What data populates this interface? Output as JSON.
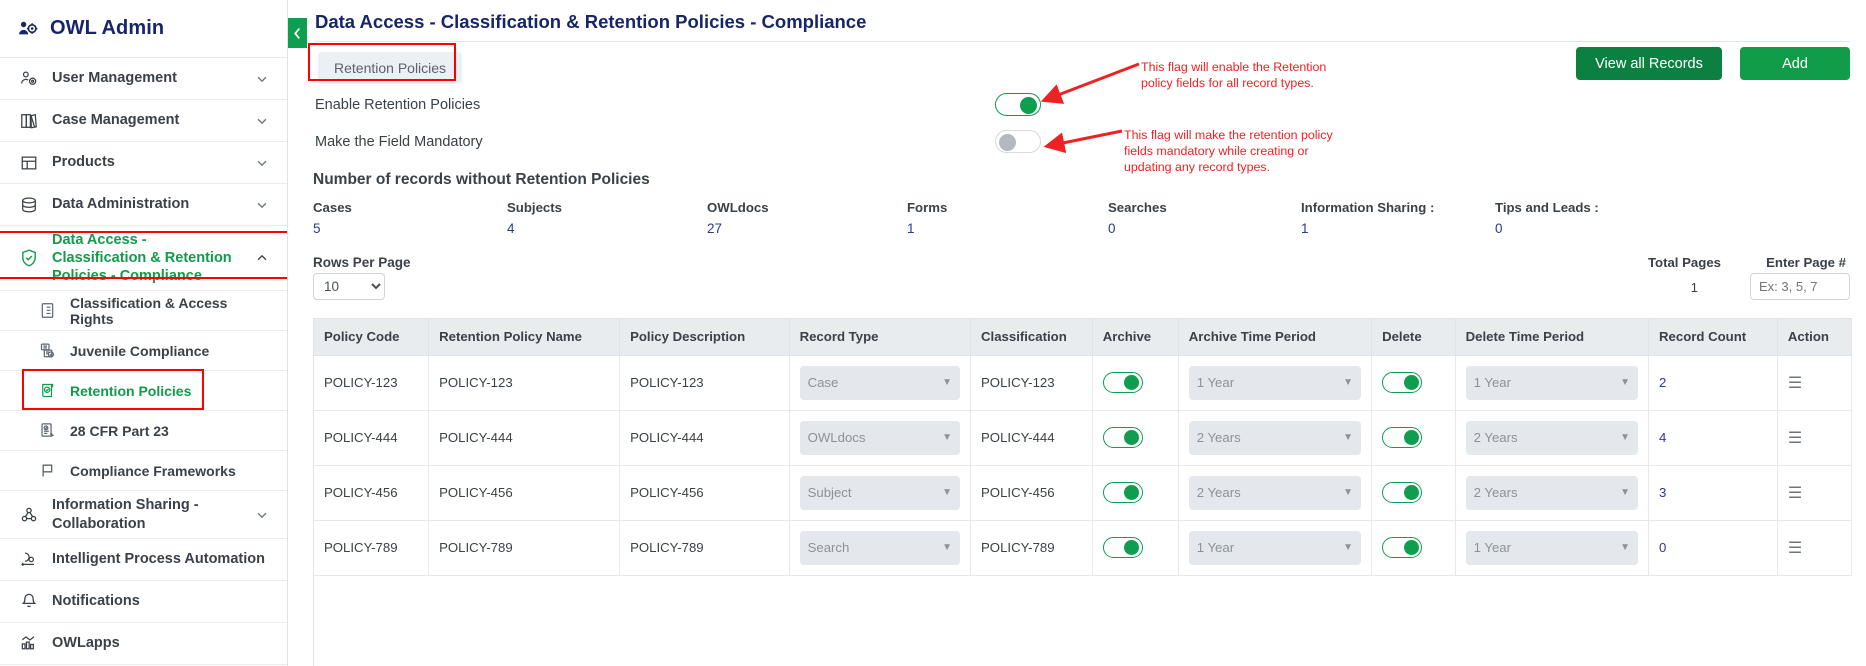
{
  "brand": {
    "title": "OWL Admin",
    "icon": "users-gear-icon"
  },
  "sidebar": {
    "items": [
      {
        "label": "User Management",
        "icon": "user-gear-icon",
        "chevron": "chevron-down-icon"
      },
      {
        "label": "Case Management",
        "icon": "books-icon",
        "chevron": "chevron-down-icon"
      },
      {
        "label": "Products",
        "icon": "layout-icon",
        "chevron": "chevron-down-icon"
      },
      {
        "label": "Data Administration",
        "icon": "database-icon",
        "chevron": "chevron-down-icon"
      },
      {
        "label": "Data Access - Classification & Retention Policies - Compliance",
        "icon": "shield-check-icon",
        "chevron": "chevron-up-icon"
      }
    ],
    "sub_items": [
      {
        "label": "Classification & Access Rights",
        "icon": "document-list-icon"
      },
      {
        "label": "Juvenile Compliance",
        "icon": "document-check-icon"
      },
      {
        "label": "Retention Policies",
        "icon": "scroll-check-icon"
      },
      {
        "label": "28 CFR Part 23",
        "icon": "document-edit-icon"
      },
      {
        "label": "Compliance Frameworks",
        "icon": "flag-icon"
      }
    ],
    "tail_items": [
      {
        "label": "Information Sharing - Collaboration",
        "icon": "share-nodes-icon",
        "chevron": "chevron-down-icon"
      },
      {
        "label": "Intelligent Process Automation",
        "icon": "automation-icon",
        "chevron": ""
      },
      {
        "label": "Notifications",
        "icon": "bell-icon",
        "chevron": ""
      },
      {
        "label": "OWLapps",
        "icon": "chart-bars-icon",
        "chevron": ""
      }
    ]
  },
  "header": {
    "title": "Data Access - Classification & Retention Policies - Compliance",
    "collapse_icon": "chevron-left-icon",
    "tab_label": "Retention Policies",
    "view_all_label": "View all Records",
    "add_label": "Add"
  },
  "flags": [
    {
      "label": "Enable Retention Policies",
      "state": "on",
      "annotation": "This flag will enable the Retention policy fields for all record types."
    },
    {
      "label": "Make the Field Mandatory",
      "state": "off",
      "annotation": "This flag will make the retention policy fields mandatory while creating or updating any record types."
    }
  ],
  "stats_section": {
    "title": "Number of records without Retention Policies",
    "items": [
      {
        "label": "Cases",
        "value": "5"
      },
      {
        "label": "Subjects",
        "value": "4"
      },
      {
        "label": "OWLdocs",
        "value": "27"
      },
      {
        "label": "Forms",
        "value": "1"
      },
      {
        "label": "Searches",
        "value": "0"
      },
      {
        "label": "Information Sharing :",
        "value": "1"
      },
      {
        "label": "Tips and Leads :",
        "value": "0"
      }
    ]
  },
  "pagination": {
    "rows_per_page_label": "Rows Per Page",
    "rows_per_page_value": "10",
    "total_pages_label": "Total Pages",
    "total_pages_value": "1",
    "enter_page_label": "Enter Page #",
    "enter_page_placeholder": "Ex: 3, 5, 7",
    "enter_page_value": ""
  },
  "table": {
    "columns": [
      "Policy Code",
      "Retention Policy Name",
      "Policy Description",
      "Record Type",
      "Classification",
      "Archive",
      "Archive Time Period",
      "Delete",
      "Delete Time Period",
      "Record Count",
      "Action"
    ],
    "rows": [
      {
        "policy_code": "POLICY-123",
        "policy_name": "POLICY-123",
        "policy_description": "POLICY-123",
        "record_type": "Case",
        "classification": "POLICY-123",
        "archive": "on",
        "archive_time": "1 Year",
        "delete": "on",
        "delete_time": "1 Year",
        "record_count": "2",
        "action_icon": "hamburger-icon"
      },
      {
        "policy_code": "POLICY-444",
        "policy_name": "POLICY-444",
        "policy_description": "POLICY-444",
        "record_type": "OWLdocs",
        "classification": "POLICY-444",
        "archive": "on",
        "archive_time": "2 Years",
        "delete": "on",
        "delete_time": "2 Years",
        "record_count": "4",
        "action_icon": "hamburger-icon"
      },
      {
        "policy_code": "POLICY-456",
        "policy_name": "POLICY-456",
        "policy_description": "POLICY-456",
        "record_type": "Subject",
        "classification": "POLICY-456",
        "archive": "on",
        "archive_time": "2 Years",
        "delete": "on",
        "delete_time": "2 Years",
        "record_count": "3",
        "action_icon": "hamburger-icon"
      },
      {
        "policy_code": "POLICY-789",
        "policy_name": "POLICY-789",
        "policy_description": "POLICY-789",
        "record_type": "Search",
        "classification": "POLICY-789",
        "archive": "on",
        "archive_time": "1 Year",
        "delete": "on",
        "delete_time": "1 Year",
        "record_count": "0",
        "action_icon": "hamburger-icon"
      }
    ]
  },
  "colors": {
    "brand_navy": "#17256b",
    "accent_green": "#119c49",
    "button_green_dark": "#0c8040",
    "annotation_red": "#ee2222",
    "link_blue": "#2b3a8f"
  }
}
